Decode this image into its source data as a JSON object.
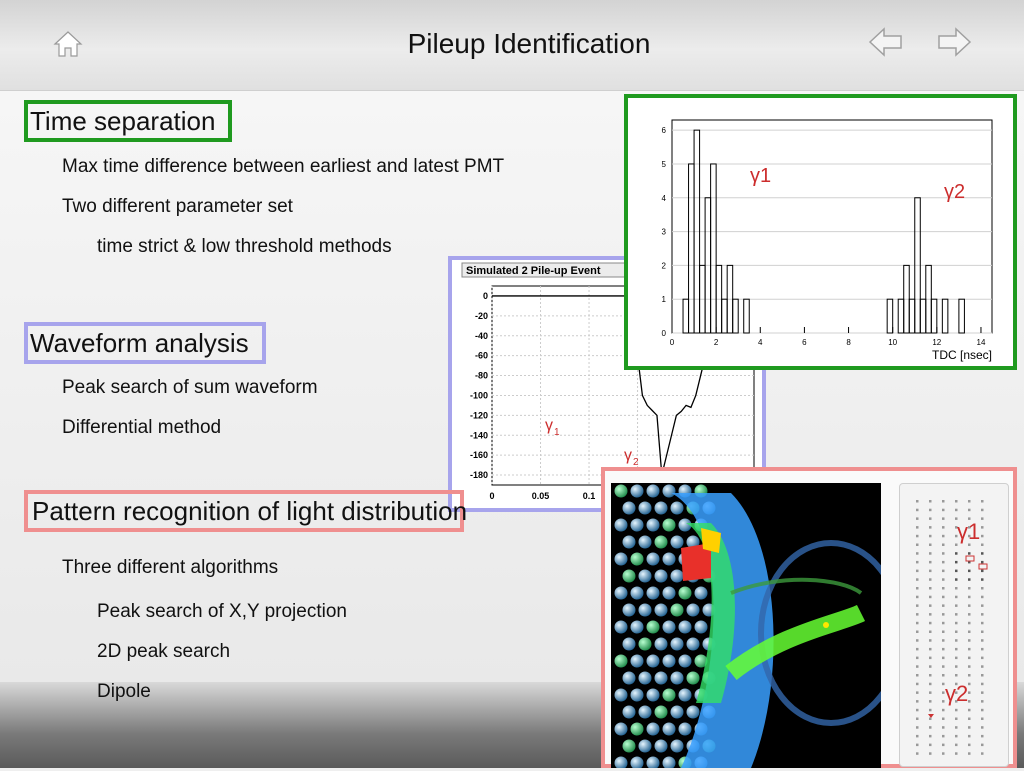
{
  "header": {
    "title": "Pileup Identification",
    "icons": {
      "home": "home-icon",
      "back": "arrow-left-icon",
      "forward": "arrow-right-icon"
    }
  },
  "colors": {
    "green": "#1f9a1f",
    "blue": "#a7a4ec",
    "red": "#ef8f8f",
    "gamma_red": "#cc2d2d"
  },
  "sections": {
    "time": {
      "heading": "Time separation",
      "bullets": [
        "Max time difference between earliest and latest PMT",
        "Two different parameter set"
      ],
      "sub_bullets": [
        "time strict & low threshold methods"
      ]
    },
    "waveform": {
      "heading": "Waveform analysis",
      "bullets": [
        "Peak search of sum waveform",
        "Differential method"
      ]
    },
    "pattern": {
      "heading": "Pattern recognition of light distribution",
      "bullets": [
        "Three different algorithms"
      ],
      "sub_bullets": [
        "Peak search of X,Y projection",
        "2D peak search",
        "Dipole"
      ]
    }
  },
  "figures": {
    "tdc_histogram": {
      "label1": "γ1",
      "label2": "γ2"
    },
    "waveform_plot": {
      "label1": "γ",
      "label1_sub": "1",
      "label2": "γ",
      "label2_sub": "2"
    },
    "detector_event": {
      "label1": "γ1",
      "label2": "γ2"
    }
  },
  "chart_data": [
    {
      "type": "bar",
      "title": "",
      "xlabel": "TDC [nsec]",
      "ylabel": "",
      "xlim": [
        0,
        14.5
      ],
      "ylim": [
        0,
        6.3
      ],
      "x_ticks": [
        0,
        2,
        4,
        6,
        8,
        10,
        12,
        14
      ],
      "y_ticks": [
        0,
        1,
        2,
        3,
        4,
        5,
        6
      ],
      "bin_width": 0.25,
      "bins": [
        [
          0.25,
          0
        ],
        [
          0.5,
          1
        ],
        [
          0.75,
          5
        ],
        [
          1.0,
          6
        ],
        [
          1.25,
          2
        ],
        [
          1.5,
          4
        ],
        [
          1.75,
          5
        ],
        [
          2.0,
          2
        ],
        [
          2.25,
          1
        ],
        [
          2.5,
          2
        ],
        [
          2.75,
          1
        ],
        [
          3.0,
          0
        ],
        [
          3.25,
          1
        ],
        [
          3.5,
          0
        ],
        [
          3.75,
          0
        ],
        [
          4.0,
          0
        ],
        [
          9.75,
          1
        ],
        [
          10.0,
          0
        ],
        [
          10.25,
          1
        ],
        [
          10.5,
          2
        ],
        [
          10.75,
          1
        ],
        [
          11.0,
          4
        ],
        [
          11.25,
          1
        ],
        [
          11.5,
          2
        ],
        [
          11.75,
          1
        ],
        [
          12.0,
          0
        ],
        [
          12.25,
          1
        ],
        [
          12.5,
          0
        ],
        [
          12.75,
          0
        ],
        [
          13.0,
          1
        ],
        [
          13.25,
          0
        ]
      ]
    },
    {
      "type": "line",
      "title": "Simulated 2 Pile-up Event",
      "xlabel": "",
      "ylabel": "",
      "xlim": [
        0,
        0.27
      ],
      "ylim": [
        -190,
        10
      ],
      "x_ticks": [
        0,
        0.05,
        0.1,
        0.15
      ],
      "x_tick_labels": [
        "0",
        "0.05",
        "0.1",
        "0.15"
      ],
      "y_ticks": [
        0,
        -20,
        -40,
        -60,
        -80,
        -100,
        -120,
        -140,
        -160,
        -180
      ],
      "x": [
        0,
        0.01,
        0.05,
        0.1,
        0.14,
        0.145,
        0.15,
        0.155,
        0.16,
        0.165,
        0.17,
        0.175,
        0.18,
        0.185,
        0.19,
        0.195,
        0.2,
        0.205,
        0.21,
        0.215,
        0.22,
        0.225,
        0.23,
        0.24,
        0.25,
        0.26,
        0.27
      ],
      "y": [
        0,
        0,
        0,
        0,
        0,
        -20,
        -60,
        -100,
        -110,
        -115,
        -120,
        -180,
        -160,
        -140,
        -120,
        -116,
        -110,
        -112,
        -100,
        -80,
        -60,
        -40,
        -30,
        -20,
        -10,
        -5,
        0
      ]
    }
  ]
}
